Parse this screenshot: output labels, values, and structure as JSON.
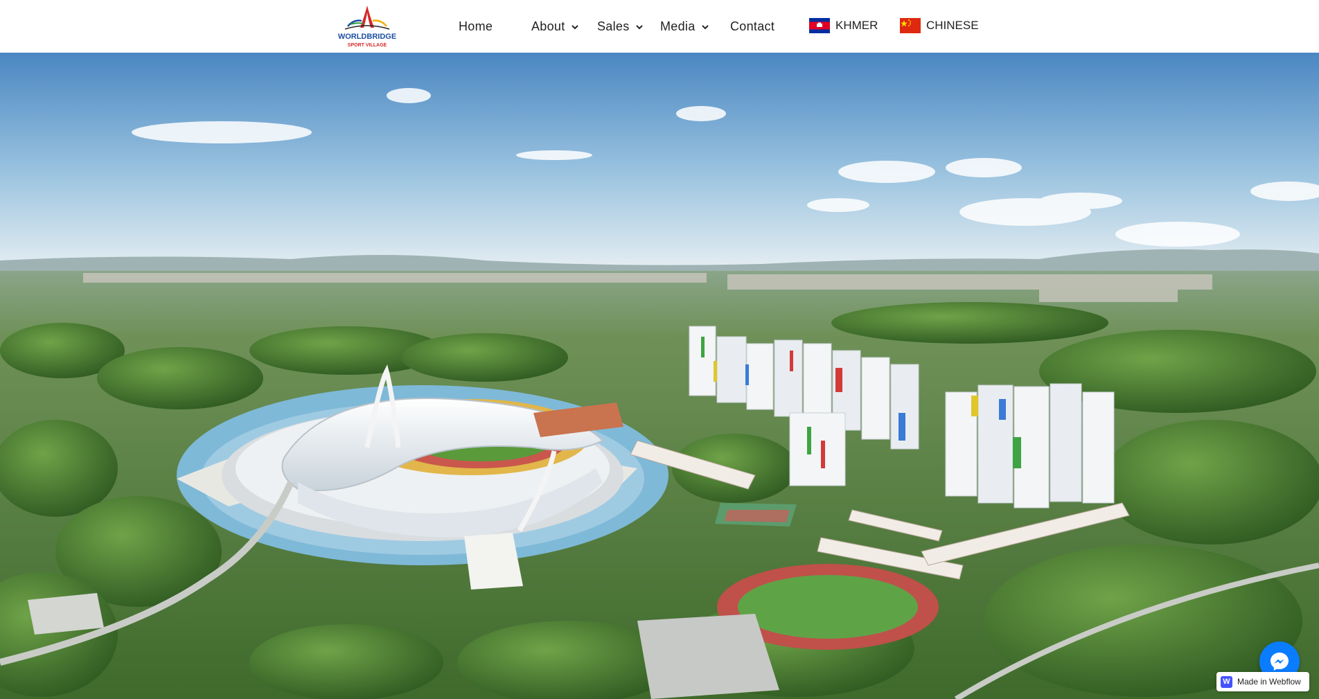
{
  "nav": {
    "logo_text_top": "WORLDBRIDGE",
    "logo_text_bottom": "SPORT VILLAGE",
    "items": [
      {
        "label": "Home"
      },
      {
        "label": "About"
      },
      {
        "label": "Sales"
      },
      {
        "label": "Media"
      },
      {
        "label": "Contact"
      }
    ],
    "languages": [
      {
        "label": "KHMER",
        "flag": "cambodia-flag-icon"
      },
      {
        "label": "CHINESE",
        "flag": "china-flag-icon"
      }
    ]
  },
  "hero": {
    "image": "aerial-rendering-stadium-and-towers",
    "sky_color": "#5b93c7",
    "greenery_color": "#4f7d3a"
  },
  "messenger": {
    "icon": "messenger-icon",
    "color": "#0a7cff"
  },
  "badge": {
    "label": "Made in Webflow",
    "icon": "webflow-icon"
  }
}
